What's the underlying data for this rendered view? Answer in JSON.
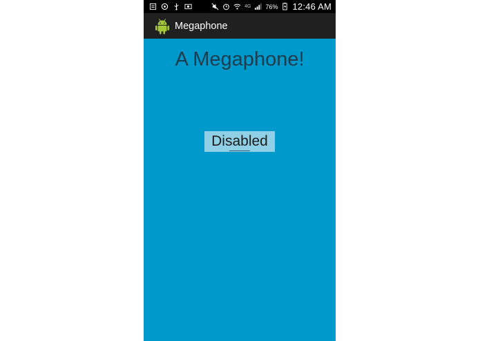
{
  "status_bar": {
    "battery_percent": "76%",
    "time": "12:46 AM",
    "network_label": "4G",
    "icons_left": [
      "notification-icon",
      "sync-icon",
      "usb-icon",
      "photo-icon"
    ],
    "icons_right": [
      "mute-icon",
      "alarm-icon",
      "wifi-icon",
      "signal-icon",
      "battery-icon"
    ]
  },
  "action_bar": {
    "app_title": "Megaphone",
    "app_icon": "android-icon"
  },
  "main": {
    "headline": "A Megaphone!",
    "button_label": "Disabled"
  },
  "colors": {
    "background": "#0099cc",
    "action_bar": "#202020",
    "status_bar": "#000000",
    "button_bg": "#8fd0e6",
    "headline_text": "#1d3d4d",
    "android_green": "#a4c639"
  }
}
